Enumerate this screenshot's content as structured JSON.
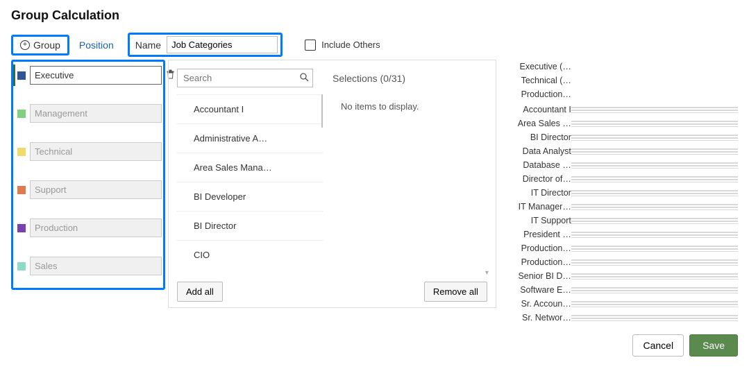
{
  "title": "Group Calculation",
  "toolbar": {
    "group_btn": "Group",
    "position_link": "Position",
    "name_label": "Name",
    "name_value": "Job Categories",
    "include_others": "Include Others"
  },
  "groups": [
    {
      "label": "Executive",
      "color": "#2f5597",
      "active": true
    },
    {
      "label": "Management",
      "color": "#7fd17f",
      "active": false
    },
    {
      "label": "Technical",
      "color": "#f2d96b",
      "active": false
    },
    {
      "label": "Support",
      "color": "#e07b4f",
      "active": false
    },
    {
      "label": "Production",
      "color": "#7a3fb0",
      "active": false
    },
    {
      "label": "Sales",
      "color": "#8fd9c9",
      "active": false
    }
  ],
  "picker": {
    "search_placeholder": "Search",
    "selections_label": "Selections (0/31)",
    "empty_text": "No items to display.",
    "available": [
      "Accountant I",
      "Administrative A…",
      "Area Sales Mana…",
      "BI Developer",
      "BI Director",
      "CIO"
    ],
    "add_all": "Add all",
    "remove_all": "Remove all"
  },
  "preview": {
    "header": [
      "Executive (…",
      "Technical (…",
      "Production…"
    ],
    "rows": [
      "Accountant I",
      "Area Sales …",
      "BI Director",
      "Data Analyst",
      "Database …",
      "Director of…",
      "IT Director",
      "IT Manager…",
      "IT Support",
      "President …",
      "Production…",
      "Production…",
      "Senior BI D…",
      "Software E…",
      "Sr. Accoun…",
      "Sr. Networ…"
    ]
  },
  "footer": {
    "cancel": "Cancel",
    "save": "Save"
  }
}
